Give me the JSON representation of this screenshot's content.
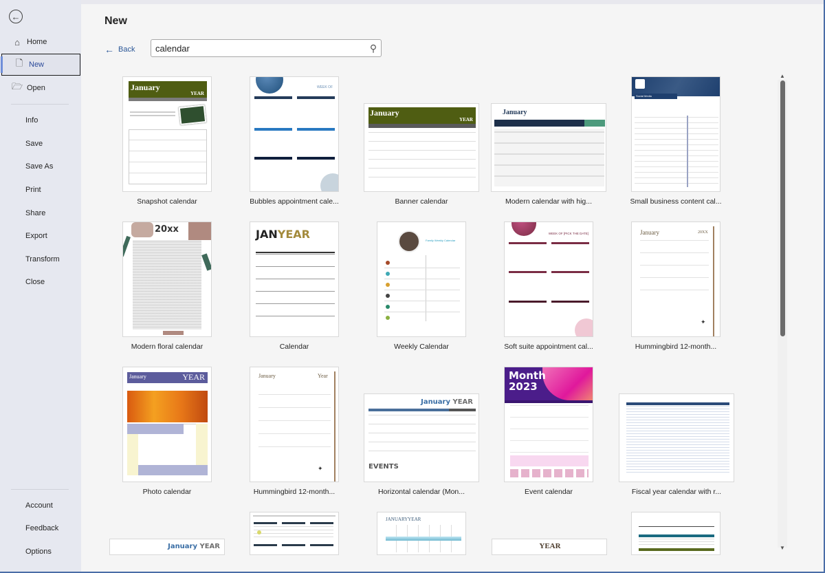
{
  "sidebar": {
    "back_icon": "arrow-left-circle-icon",
    "items": [
      {
        "label": "Home",
        "icon": "home-icon"
      },
      {
        "label": "New",
        "icon": "new-document-icon",
        "selected": true
      },
      {
        "label": "Open",
        "icon": "folder-open-icon"
      },
      {
        "label": "Info"
      },
      {
        "label": "Save"
      },
      {
        "label": "Save As"
      },
      {
        "label": "Print"
      },
      {
        "label": "Share"
      },
      {
        "label": "Export"
      },
      {
        "label": "Transform"
      },
      {
        "label": "Close"
      }
    ],
    "footer_items": [
      {
        "label": "Account"
      },
      {
        "label": "Feedback"
      },
      {
        "label": "Options"
      }
    ]
  },
  "main": {
    "title": "New",
    "back_label": "Back",
    "search": {
      "value": "calendar",
      "placeholder": ""
    },
    "templates": [
      {
        "label": "Snapshot calendar",
        "thumb_text": [
          "January",
          "YEAR"
        ]
      },
      {
        "label": "Bubbles appointment cale...",
        "thumb_text": [
          "WEEK OF"
        ]
      },
      {
        "label": "Banner calendar",
        "thumb_text": [
          "January",
          "YEAR"
        ]
      },
      {
        "label": "Modern calendar with hig...",
        "thumb_text": [
          "January"
        ]
      },
      {
        "label": "Small business content cal...",
        "thumb_text": [
          "Social Media"
        ]
      },
      {
        "label": "Modern floral calendar",
        "thumb_text": [
          "20xx"
        ]
      },
      {
        "label": "Calendar",
        "thumb_text": [
          "JAN",
          "YEAR"
        ]
      },
      {
        "label": "Weekly Calendar",
        "thumb_text": [
          "Family Weekly Calendar"
        ]
      },
      {
        "label": "Soft suite appointment cal...",
        "thumb_text": [
          "WEEK OF [PICK THE DATE]"
        ]
      },
      {
        "label": "Hummingbird 12-month...",
        "thumb_text": [
          "January",
          "20XX"
        ]
      },
      {
        "label": "Photo calendar",
        "thumb_text": [
          "January",
          "YEAR"
        ]
      },
      {
        "label": "Hummingbird 12-month...",
        "thumb_text": [
          "January",
          "Year"
        ]
      },
      {
        "label": "Horizontal calendar (Mon...",
        "thumb_text": [
          "January",
          "YEAR",
          "EVENTS"
        ]
      },
      {
        "label": "Event calendar",
        "thumb_text": [
          "Month",
          "2023"
        ]
      },
      {
        "label": "Fiscal year calendar with r...",
        "thumb_text": []
      },
      {
        "label": "",
        "thumb_text": [
          "January",
          "YEAR"
        ]
      },
      {
        "label": "",
        "thumb_text": []
      },
      {
        "label": "",
        "thumb_text": [
          "JANUARY",
          "YEAR"
        ]
      },
      {
        "label": "",
        "thumb_text": [
          "YEAR"
        ]
      },
      {
        "label": "",
        "thumb_text": []
      }
    ]
  },
  "scrollbar": {
    "position_fraction": 0.0,
    "visible_fraction": 0.55
  },
  "colors": {
    "accent_blue": "#2b5797",
    "sidebar_bg": "#e6e8f0",
    "olive": "#4f5d12",
    "navy": "#1f3552",
    "purple": "#4b1d8a",
    "magenta": "#e0189c",
    "maroon": "#7a2c44"
  }
}
